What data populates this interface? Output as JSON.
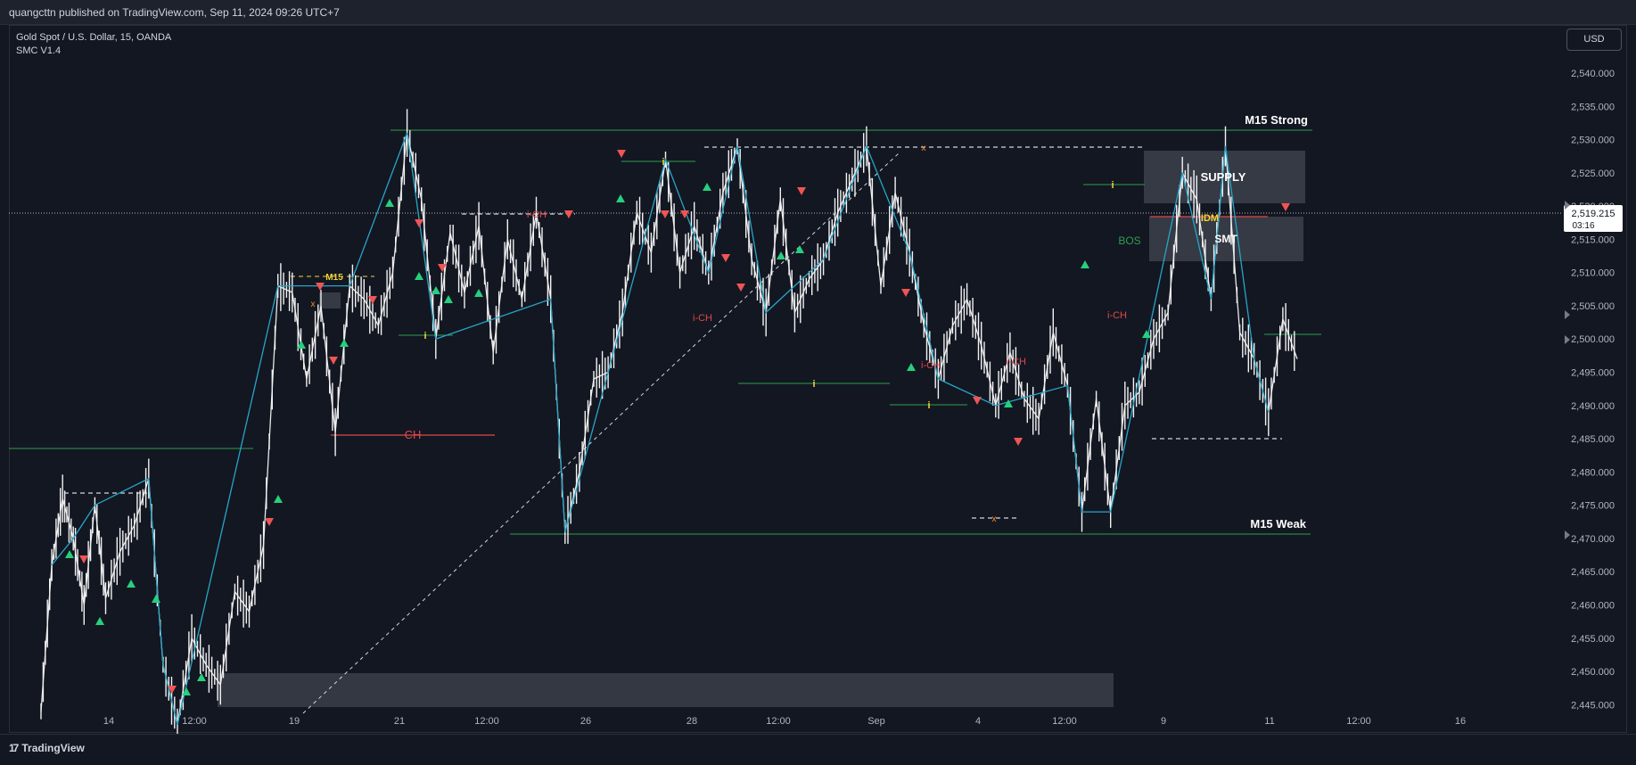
{
  "header": {
    "published_by": "quangcttn published on TradingView.com, Sep 11, 2024 09:26 UTC+7"
  },
  "legend": {
    "symbol": "Gold Spot / U.S. Dollar, 15, OANDA",
    "indicator": "SMC V1.4"
  },
  "currency_button": "USD",
  "footer": {
    "brand": "TradingView"
  },
  "colors": {
    "background": "#131722",
    "bullish_marker": "#26d07c",
    "bearish_marker": "#f05454",
    "zigzag": "#27a5c8",
    "structure_green": "#2e9e4f",
    "choch_red": "#e04848",
    "idm_yellow": "#f0d43a"
  },
  "chart_data": {
    "type": "line",
    "title": "",
    "xlabel": "",
    "ylabel": "",
    "ylim": [
      2445,
      2543
    ],
    "y_ticks": [
      "2,540.000",
      "2,535.000",
      "2,530.000",
      "2,525.000",
      "2,520.000",
      "2,515.000",
      "2,510.000",
      "2,505.000",
      "2,500.000",
      "2,495.000",
      "2,490.000",
      "2,485.000",
      "2,480.000",
      "2,475.000",
      "2,470.000",
      "2,465.000",
      "2,460.000",
      "2,455.000",
      "2,450.000",
      "2,445.000"
    ],
    "x_ticks": [
      "14",
      "12:00",
      "19",
      "21",
      "12:00",
      "26",
      "28",
      "12:00",
      "Sep",
      "4",
      "12:00",
      "9",
      "11",
      "12:00",
      "16"
    ],
    "last_price": "2,519.215",
    "countdown": "03:16",
    "series": [
      {
        "x": [
          0,
          3,
          6,
          9,
          12,
          15,
          18,
          22,
          26,
          30,
          34,
          38,
          42,
          46,
          50,
          54,
          58,
          62,
          66,
          70,
          74,
          78,
          82,
          86,
          90,
          94,
          98,
          102,
          106,
          110,
          114,
          118,
          122,
          126,
          130,
          134,
          138,
          142,
          146,
          150,
          154,
          158,
          162,
          166,
          170,
          174,
          178,
          182,
          186,
          190,
          194,
          198,
          202,
          206,
          210,
          214,
          218,
          222,
          226,
          230,
          234,
          238,
          242,
          246,
          250,
          254,
          258,
          262,
          266,
          270,
          274,
          278,
          282,
          286,
          290,
          294,
          298,
          302,
          306,
          310,
          314,
          318,
          322,
          326,
          330,
          334,
          338,
          342,
          346,
          350
        ],
        "values": [
          2444,
          2466,
          2476,
          2470,
          2460,
          2475,
          2461,
          2468,
          2472,
          2479,
          2451,
          2442,
          2455,
          2451,
          2448,
          2462,
          2459,
          2469,
          2508,
          2507,
          2494,
          2505,
          2486,
          2508,
          2506,
          2502,
          2510,
          2531,
          2521,
          2500,
          2516,
          2507,
          2517,
          2498,
          2515,
          2506,
          2519,
          2506,
          2471,
          2480,
          2494,
          2495,
          2504,
          2519,
          2513,
          2527,
          2510,
          2517,
          2510,
          2522,
          2529,
          2512,
          2504,
          2521,
          2504,
          2509,
          2512,
          2519,
          2524,
          2529,
          2508,
          2522,
          2513,
          2502,
          2494,
          2502,
          2506,
          2499,
          2490,
          2498,
          2491,
          2488,
          2501,
          2493,
          2474,
          2491,
          2474,
          2490,
          2492,
          2500,
          2504,
          2525,
          2521,
          2506,
          2529,
          2501,
          2497,
          2489,
          2503,
          2497
        ]
      }
    ],
    "annotations": [
      "M15 Strong",
      "M15 Weak",
      "SUPPLY",
      "SMT",
      "IDM",
      "BOS",
      "CH",
      "i-CH",
      "i-CH",
      "i-CH",
      "i-CH",
      "i-CH",
      "M15",
      "i",
      "i",
      "i",
      "i",
      "i",
      "x",
      "x",
      "x"
    ]
  }
}
